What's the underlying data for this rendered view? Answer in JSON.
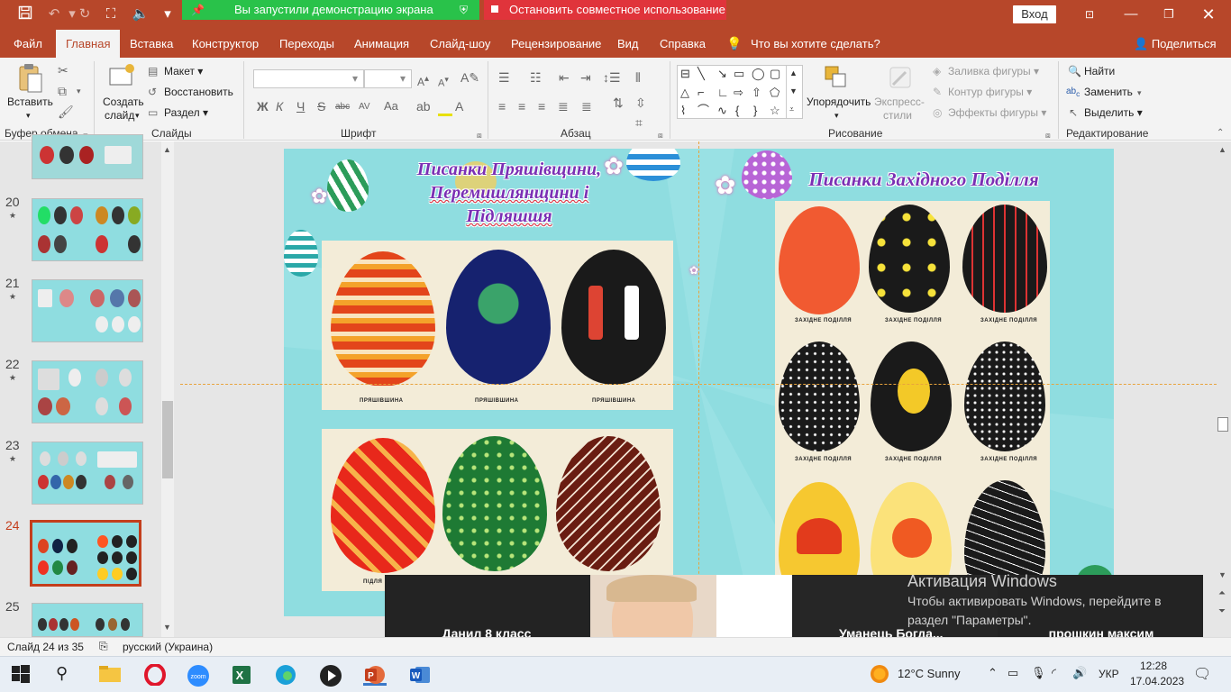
{
  "titlebar": {
    "save_icon": "save-icon",
    "undo_icon": "undo-icon",
    "redo_icon": "redo-icon",
    "sharing_message": "Вы запустили демонстрацию экрана",
    "stop_sharing": "Остановить совместное использование",
    "login": "Вход",
    "brand_color": "#b7472a"
  },
  "tabs": [
    "Файл",
    "Главная",
    "Вставка",
    "Конструктор",
    "Переходы",
    "Анимация",
    "Слайд-шоу",
    "Рецензирование",
    "Вид",
    "Справка",
    "Что вы хотите сделать?"
  ],
  "share_label": "Поделиться",
  "ribbon": {
    "clipboard": {
      "paste": "Вставить",
      "label": "Буфер обмена"
    },
    "slides": {
      "new_slide_l1": "Создать",
      "new_slide_l2": "слайд",
      "layout": "Макет",
      "reset": "Восстановить",
      "section": "Раздел",
      "label": "Слайды"
    },
    "font": {
      "label": "Шрифт",
      "bold": "Ж",
      "italic": "К",
      "underline": "Ч",
      "strike": "S",
      "shadow": "abc",
      "spacing": "AV",
      "case": "Aa",
      "color": "A"
    },
    "paragraph": {
      "label": "Абзац"
    },
    "drawing": {
      "arrange": "Упорядочить",
      "quick_styles_l1": "Экспресс-",
      "quick_styles_l2": "стили",
      "fill": "Заливка фигуры",
      "outline": "Контур фигуры",
      "effects": "Эффекты фигуры",
      "label": "Рисование"
    },
    "editing": {
      "find": "Найти",
      "replace": "Заменить",
      "select": "Выделить",
      "label": "Редактирование"
    }
  },
  "thumbnails": [
    {
      "num": "20",
      "starred": true
    },
    {
      "num": "21",
      "starred": true
    },
    {
      "num": "22",
      "starred": true
    },
    {
      "num": "23",
      "starred": true
    },
    {
      "num": "24",
      "starred": false,
      "active": true
    },
    {
      "num": "25",
      "starred": false
    }
  ],
  "slide": {
    "title_left_l1": "Писанки Пряшівщини,",
    "title_left_l2": "Перемишлянщини і",
    "title_left_l3": "Підляшшя",
    "title_right": "Писанки Західного Поділля",
    "caption_prya": "ПРЯШІВШИНА",
    "caption_pidl": "ПІДЛЯ",
    "caption_zp": "ЗАХІДНЕ ПОДІЛЛЯ"
  },
  "video": {
    "participant_1": "Данил 8 класс",
    "participant_3": "Уманець  Богда...",
    "participant_4": "прошкин максим"
  },
  "watermark": {
    "title": "Активация Windows",
    "line1": "Чтобы активировать Windows, перейдите в",
    "line2": "раздел \"Параметры\"."
  },
  "status": {
    "slide_info": "Слайд 24 из 35",
    "language": "русский (Украина)"
  },
  "taskbar": {
    "weather": "12°C  Sunny",
    "lang": "УКР",
    "time": "12:28",
    "date": "17.04.2023"
  }
}
